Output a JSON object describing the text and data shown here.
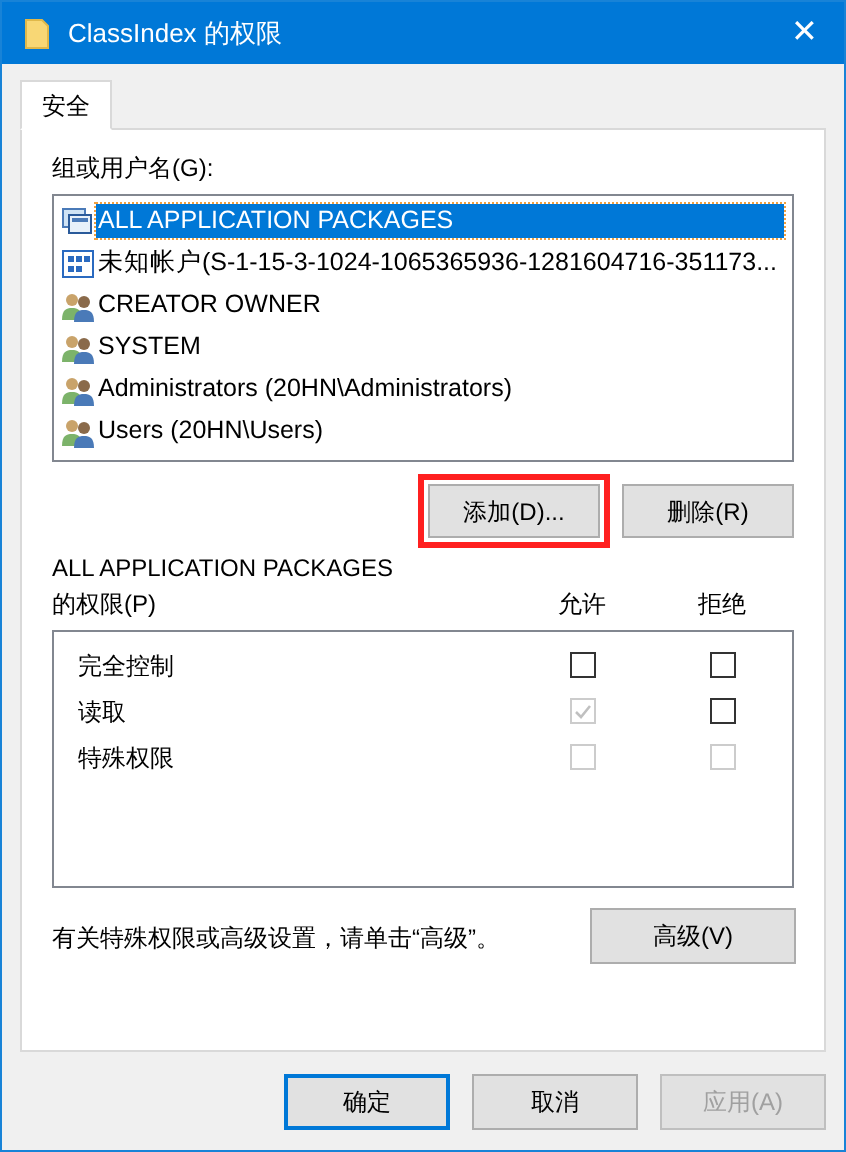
{
  "window": {
    "title": "ClassIndex 的权限",
    "close": "✕"
  },
  "tabs": [
    {
      "label": "安全",
      "selected": true
    }
  ],
  "group_label": "组或用户名(G):",
  "users": [
    {
      "kind": "package",
      "name": "ALL APPLICATION PACKAGES",
      "selected": true
    },
    {
      "kind": "unknown",
      "name": "未知帐户(S-1-15-3-1024-1065365936-1281604716-351173...",
      "selected": false
    },
    {
      "kind": "group",
      "name": "CREATOR OWNER",
      "selected": false
    },
    {
      "kind": "group",
      "name": "SYSTEM",
      "selected": false
    },
    {
      "kind": "group",
      "name": "Administrators (20HN\\Administrators)",
      "selected": false
    },
    {
      "kind": "group",
      "name": "Users (20HN\\Users)",
      "selected": false
    }
  ],
  "user_buttons": [
    {
      "label": "添加(D)...",
      "highlighted": true
    },
    {
      "label": "删除(R)",
      "highlighted": false
    }
  ],
  "permissions_heading": [
    "ALL APPLICATION PACKAGES",
    "的权限(P)"
  ],
  "columns": [
    "允许",
    "拒绝"
  ],
  "permissions": [
    {
      "name": "完全控制",
      "allow": {
        "checked": false,
        "disabled": false
      },
      "deny": {
        "checked": false,
        "disabled": false
      }
    },
    {
      "name": "读取",
      "allow": {
        "checked": true,
        "disabled": true
      },
      "deny": {
        "checked": false,
        "disabled": false
      }
    },
    {
      "name": "特殊权限",
      "allow": {
        "checked": false,
        "disabled": true
      },
      "deny": {
        "checked": false,
        "disabled": true
      }
    }
  ],
  "advanced_note": "有关特殊权限或高级设置，请单击“高级”。",
  "advanced_button": "高级(V)",
  "dialog_buttons": [
    {
      "label": "确定",
      "default": true,
      "disabled": false
    },
    {
      "label": "取消",
      "default": false,
      "disabled": false
    },
    {
      "label": "应用(A)",
      "default": false,
      "disabled": true
    }
  ]
}
